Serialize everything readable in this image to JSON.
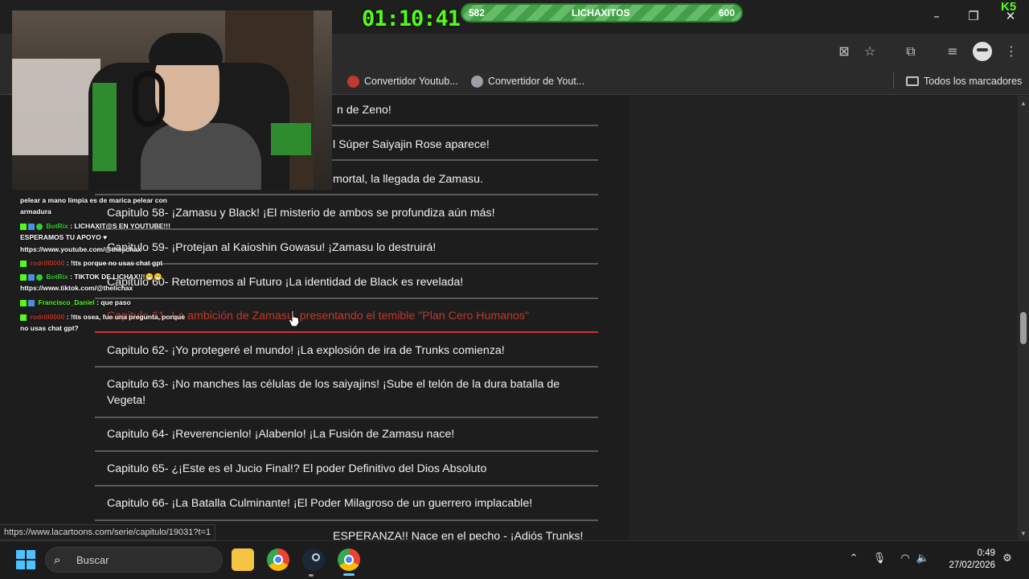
{
  "stream": {
    "timer": "01:10:41",
    "goal_current": "582",
    "goal_label": "LICHAXITOS",
    "goal_target": "600",
    "brand_color": "#53fc18",
    "platform_logo": "K5"
  },
  "bookmarks": {
    "items": [
      {
        "label": "Convertidor Youtub...",
        "icon": "youtube-converter-icon"
      },
      {
        "label": "Convertidor de Yout...",
        "icon": "globe-icon"
      }
    ],
    "all_bookmarks": "Todos los marcadores"
  },
  "episodes": [
    {
      "label": "n de Zeno!"
    },
    {
      "label": "l Súper Saiyajin Rose aparece!"
    },
    {
      "label": "mortal, la llegada de Zamasu."
    },
    {
      "label": "Capitulo 58- ¡Zamasu y Black! ¡El misterio de ambos se profundiza aún más!"
    },
    {
      "label": "Capitulo 59- ¡Protejan al Kaioshin Gowasu! ¡Zamasu lo destruirá!"
    },
    {
      "label": "Capitulo 60- Retornemos al Futuro ¡La identidad de Black es revelada!"
    },
    {
      "label": "Capitulo 61- La ambición de Zamasu, presentando el temible \"Plan Cero Humanos\""
    },
    {
      "label": "Capitulo 62- ¡Yo protegeré el mundo! ¡La explosión de ira de Trunks comienza!"
    },
    {
      "label": "Capitulo 63- ¡No manches las células de los saiyajins! ¡Sube el telón de la dura batalla de Vegeta!"
    },
    {
      "label": "Capitulo 64- ¡Reverencienlo! ¡Alabenlo! ¡La Fusión de Zamasu nace!"
    },
    {
      "label": "Capitulo 65- ¿¡Este es el Jucio Final!? El poder Definitivo del Dios Absoluto"
    },
    {
      "label": "Capitulo 66- ¡La Batalla Culminante! ¡El Poder Milagroso de un guerrero implacable!"
    },
    {
      "label": "ESPERANZA!! Nace en el pecho - ¡Adiós Trunks!"
    }
  ],
  "chat": {
    "lines": [
      {
        "user": "",
        "text": "pelear a mano limpia es de marica pelear con"
      },
      {
        "user": "",
        "text": "armadura"
      },
      {
        "user": "BotRix",
        "text": ": LICHAXIT@S EN YOUTUBE!!!"
      },
      {
        "user": "",
        "text": "ESPERAMOS TU APOYO ♥"
      },
      {
        "user": "",
        "text": "https://www.youtube.com/@thelichax"
      },
      {
        "user": "rodrill0000",
        "text": ": !tts porque no usas chat gpt"
      },
      {
        "user": "BotRix",
        "text": ": TIKTOK DE LICHAX!!!😁😁"
      },
      {
        "user": "",
        "text": "https://www.tiktok.com/@thelichax"
      },
      {
        "user": "Francisco_Daniel",
        "text": ": que paso"
      },
      {
        "user": "rodrill0000",
        "text": ": !tts osea, fue una pregunta, porque"
      },
      {
        "user": "",
        "text": "no usas chat gpt?"
      }
    ]
  },
  "status_url": "https://www.lacartoons.com/serie/capitulo/19031?t=1",
  "taskbar": {
    "search_placeholder": "Buscar",
    "time": "0:49",
    "date": "27/02/2026"
  }
}
